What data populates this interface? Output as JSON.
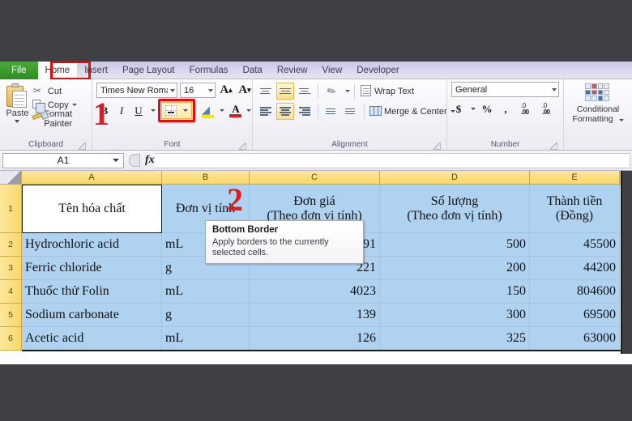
{
  "ribbon": {
    "tabs": [
      {
        "label": "File",
        "id": "file"
      },
      {
        "label": "Home",
        "id": "home"
      },
      {
        "label": "Insert",
        "id": "insert"
      },
      {
        "label": "Page Layout",
        "id": "page-layout"
      },
      {
        "label": "Formulas",
        "id": "formulas"
      },
      {
        "label": "Data",
        "id": "data"
      },
      {
        "label": "Review",
        "id": "review"
      },
      {
        "label": "View",
        "id": "view"
      },
      {
        "label": "Developer",
        "id": "developer"
      }
    ],
    "active_tab": "Home",
    "groups": {
      "clipboard": {
        "label": "Clipboard",
        "paste": "Paste",
        "cut": "Cut",
        "copy": "Copy",
        "format_painter": "Format Painter"
      },
      "font": {
        "label": "Font",
        "font_name": "Times New Roma",
        "font_size": "16",
        "grow_font": "A",
        "shrink_font": "A",
        "bold": "B",
        "italic": "I",
        "underline": "U",
        "borders": "Borders",
        "fill_color": "Fill Color",
        "font_color": "A"
      },
      "alignment": {
        "label": "Alignment",
        "wrap_text": "Wrap Text",
        "merge_center": "Merge & Center"
      },
      "number": {
        "label": "Number",
        "format": "General",
        "currency": "$",
        "percent": "%",
        "comma": ",",
        "increase_decimal": ".0",
        "decrease_decimal": ".00"
      },
      "styles": {
        "conditional_formatting_line1": "Conditional",
        "conditional_formatting_line2": "Formatting"
      }
    }
  },
  "annotations": {
    "step1": "1",
    "step2": "2"
  },
  "tooltip": {
    "title": "Bottom Border",
    "body": "Apply borders to the currently selected cells."
  },
  "formula_bar": {
    "name_box": "A1",
    "formula": ""
  },
  "sheet": {
    "column_headers": [
      "A",
      "B",
      "C",
      "D",
      "E"
    ],
    "row_headers": [
      "1",
      "2",
      "3",
      "4",
      "5",
      "6"
    ],
    "header_row": {
      "a": "Tên hóa chất",
      "b": "Đơn vị tính",
      "c_line1": "Đơn giá",
      "c_line2": "(Theo đơn vị tính)",
      "d_line1": "Số lượng",
      "d_line2": "(Theo đơn vị tính)",
      "e_line1": "Thành tiền",
      "e_line2": "(Đồng)"
    },
    "rows": [
      {
        "name": "Hydrochloric acid",
        "unit": "mL",
        "price": "91",
        "qty": "500",
        "total": "45500"
      },
      {
        "name": "Ferric chloride",
        "unit": "g",
        "price": "221",
        "qty": "200",
        "total": "44200"
      },
      {
        "name": "Thuốc thử Folin",
        "unit": "mL",
        "price": "4023",
        "qty": "150",
        "total": "804600"
      },
      {
        "name": "Sodium carbonate",
        "unit": "g",
        "price": "139",
        "qty": "300",
        "total": "69500"
      },
      {
        "name": "Acetic acid",
        "unit": "mL",
        "price": "126",
        "qty": "325",
        "total": "63000"
      }
    ]
  },
  "colors": {
    "accent_red": "#e8090b",
    "selection_blue": "#aed2f0",
    "header_yellow": "#f8d76a",
    "file_tab_green": "#2e8b22"
  }
}
